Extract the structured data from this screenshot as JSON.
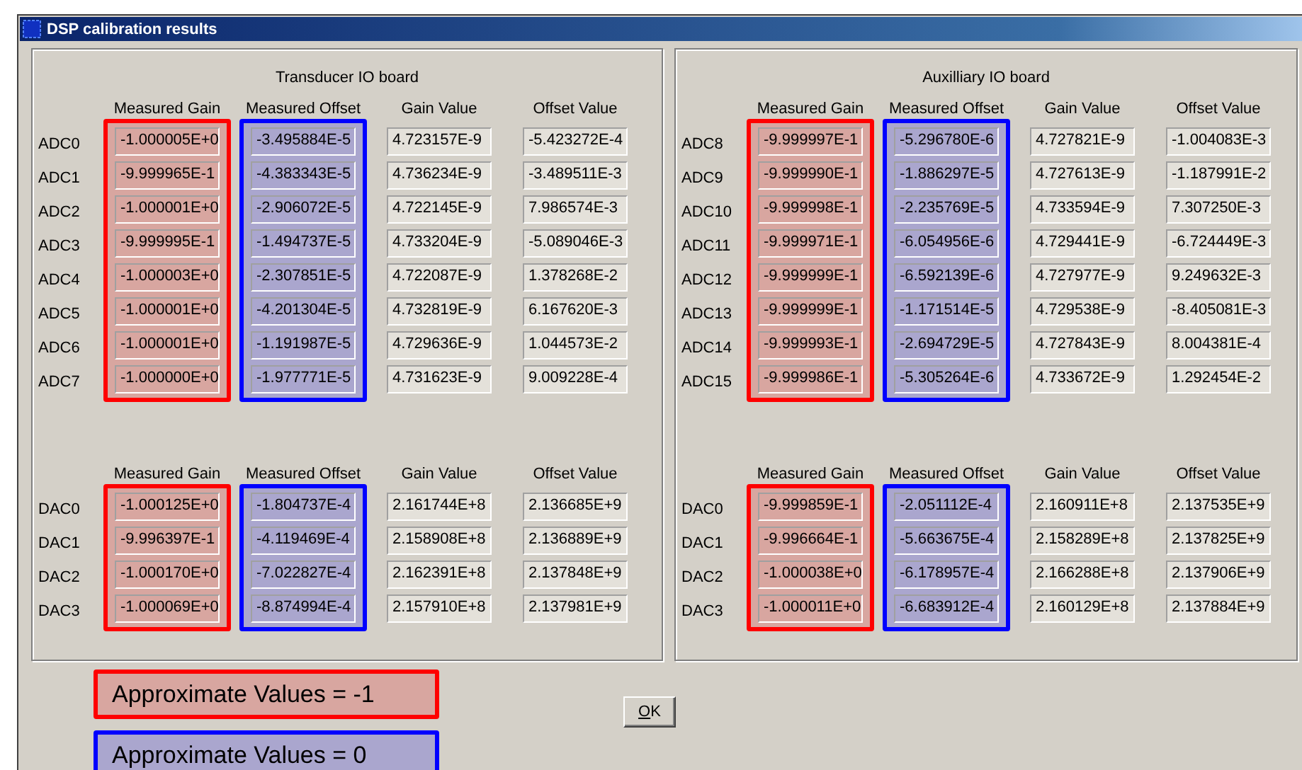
{
  "window": {
    "title": "DSP calibration results"
  },
  "boards": [
    {
      "title": "Transducer IO board",
      "sections": [
        {
          "columns": [
            {
              "label": "Measured Gain",
              "color": "#ff0000"
            },
            {
              "label": "Measured Offset",
              "color": "#0000ff"
            },
            {
              "label": "Gain Value"
            },
            {
              "label": "Offset Value"
            }
          ],
          "rows": [
            {
              "label": "ADC0",
              "values": [
                "-1.000005E+0",
                "-3.495884E-5",
                "4.723157E-9",
                "-5.423272E-4"
              ]
            },
            {
              "label": "ADC1",
              "values": [
                "-9.999965E-1",
                "-4.383343E-5",
                "4.736234E-9",
                "-3.489511E-3"
              ]
            },
            {
              "label": "ADC2",
              "values": [
                "-1.000001E+0",
                "-2.906072E-5",
                "4.722145E-9",
                "7.986574E-3"
              ]
            },
            {
              "label": "ADC3",
              "values": [
                "-9.999995E-1",
                "-1.494737E-5",
                "4.733204E-9",
                "-5.089046E-3"
              ]
            },
            {
              "label": "ADC4",
              "values": [
                "-1.000003E+0",
                "-2.307851E-5",
                "4.722087E-9",
                "1.378268E-2"
              ]
            },
            {
              "label": "ADC5",
              "values": [
                "-1.000001E+0",
                "-4.201304E-5",
                "4.732819E-9",
                "6.167620E-3"
              ]
            },
            {
              "label": "ADC6",
              "values": [
                "-1.000001E+0",
                "-1.191987E-5",
                "4.729636E-9",
                "1.044573E-2"
              ]
            },
            {
              "label": "ADC7",
              "values": [
                "-1.000000E+0",
                "-1.977771E-5",
                "4.731623E-9",
                "9.009228E-4"
              ]
            }
          ]
        },
        {
          "columns": [
            {
              "label": "Measured Gain",
              "color": "#ff0000"
            },
            {
              "label": "Measured Offset",
              "color": "#0000ff"
            },
            {
              "label": "Gain Value"
            },
            {
              "label": "Offset Value"
            }
          ],
          "rows": [
            {
              "label": "DAC0",
              "values": [
                "-1.000125E+0",
                "-1.804737E-4",
                "2.161744E+8",
                "2.136685E+9"
              ]
            },
            {
              "label": "DAC1",
              "values": [
                "-9.996397E-1",
                "-4.119469E-4",
                "2.158908E+8",
                "2.136889E+9"
              ]
            },
            {
              "label": "DAC2",
              "values": [
                "-1.000170E+0",
                "-7.022827E-4",
                "2.162391E+8",
                "2.137848E+9"
              ]
            },
            {
              "label": "DAC3",
              "values": [
                "-1.000069E+0",
                "-8.874994E-4",
                "2.157910E+8",
                "2.137981E+9"
              ]
            }
          ]
        }
      ]
    },
    {
      "title": "Auxilliary IO board",
      "sections": [
        {
          "columns": [
            {
              "label": "Measured Gain",
              "color": "#ff0000"
            },
            {
              "label": "Measured Offset",
              "color": "#0000ff"
            },
            {
              "label": "Gain Value"
            },
            {
              "label": "Offset Value"
            }
          ],
          "rows": [
            {
              "label": "ADC8",
              "values": [
                "-9.999997E-1",
                "-5.296780E-6",
                "4.727821E-9",
                "-1.004083E-3"
              ]
            },
            {
              "label": "ADC9",
              "values": [
                "-9.999990E-1",
                "-1.886297E-5",
                "4.727613E-9",
                "-1.187991E-2"
              ]
            },
            {
              "label": "ADC10",
              "values": [
                "-9.999998E-1",
                "-2.235769E-5",
                "4.733594E-9",
                "7.307250E-3"
              ]
            },
            {
              "label": "ADC11",
              "values": [
                "-9.999971E-1",
                "-6.054956E-6",
                "4.729441E-9",
                "-6.724449E-3"
              ]
            },
            {
              "label": "ADC12",
              "values": [
                "-9.999999E-1",
                "-6.592139E-6",
                "4.727977E-9",
                "9.249632E-3"
              ]
            },
            {
              "label": "ADC13",
              "values": [
                "-9.999999E-1",
                "-1.171514E-5",
                "4.729538E-9",
                "-8.405081E-3"
              ]
            },
            {
              "label": "ADC14",
              "values": [
                "-9.999993E-1",
                "-2.694729E-5",
                "4.727843E-9",
                "8.004381E-4"
              ]
            },
            {
              "label": "ADC15",
              "values": [
                "-9.999986E-1",
                "-5.305264E-6",
                "4.733672E-9",
                "1.292454E-2"
              ]
            }
          ]
        },
        {
          "columns": [
            {
              "label": "Measured Gain",
              "color": "#ff0000"
            },
            {
              "label": "Measured Offset",
              "color": "#0000ff"
            },
            {
              "label": "Gain Value"
            },
            {
              "label": "Offset Value"
            }
          ],
          "rows": [
            {
              "label": "DAC0",
              "values": [
                "-9.999859E-1",
                "-2.051112E-4",
                "2.160911E+8",
                "2.137535E+9"
              ]
            },
            {
              "label": "DAC1",
              "values": [
                "-9.996664E-1",
                "-5.663675E-4",
                "2.158289E+8",
                "2.137825E+9"
              ]
            },
            {
              "label": "DAC2",
              "values": [
                "-1.000038E+0",
                "-6.178957E-4",
                "2.166288E+8",
                "2.137906E+9"
              ]
            },
            {
              "label": "DAC3",
              "values": [
                "-1.000011E+0",
                "-6.683912E-4",
                "2.160129E+8",
                "2.137884E+9"
              ]
            }
          ]
        }
      ]
    }
  ],
  "legend": [
    {
      "text": "Approximate Values = -1",
      "color": "#ff0000"
    },
    {
      "text": "Approximate Values = 0",
      "color": "#0000ff"
    }
  ],
  "ok_button": "OK"
}
